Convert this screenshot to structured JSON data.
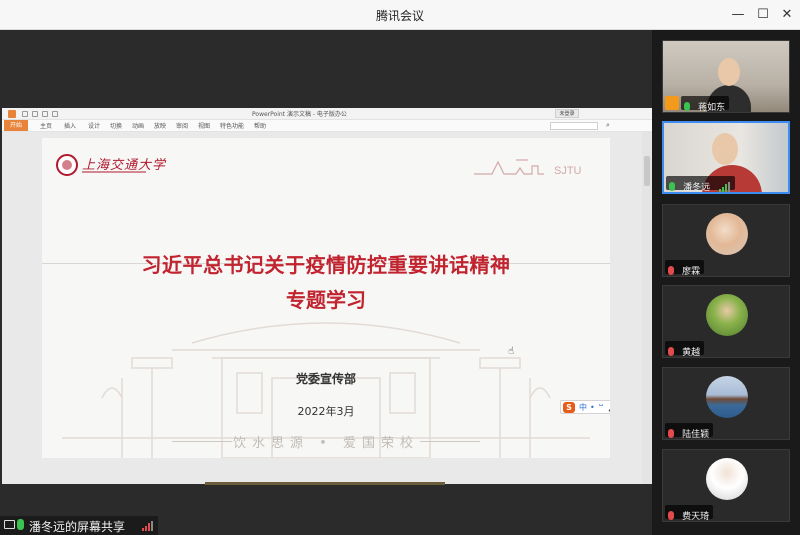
{
  "window": {
    "title": "腾讯会议",
    "controls": {
      "minimize": "—",
      "maximize": "☐",
      "close": "✕"
    }
  },
  "ppt": {
    "doc_title": "PowerPoint 演示文稿 - 电子版办公",
    "login_label": "未登录",
    "tabs": [
      "开始",
      "主页",
      "插入",
      "设计",
      "切换",
      "动画",
      "放映",
      "审阅",
      "视图",
      "特色功能",
      "帮助"
    ],
    "search_icon": "⌕"
  },
  "slide": {
    "logo_text": "上海交通大学",
    "headline_line1": "习近平总书记关于疫情防控重要讲话精神",
    "headline_line2": "专题学习",
    "department": "党委宣传部",
    "date": "2022年3月",
    "motto": "饮水思源 • 爱国荣校",
    "sjtu_mark": "SJTU"
  },
  "ime": {
    "logo": "S",
    "items": [
      "中",
      "•",
      "ⵯ",
      "🎤",
      "⊞",
      "👕",
      "⋮"
    ]
  },
  "share_status": {
    "label": "潘冬远的屏幕共享"
  },
  "participants": [
    {
      "name": "蒋如东",
      "mic": "on",
      "host": true,
      "video": true
    },
    {
      "name": "潘冬远",
      "mic": "on",
      "host": false,
      "video": true,
      "active": true
    },
    {
      "name": "廖霖",
      "mic": "muted",
      "host": false,
      "video": false
    },
    {
      "name": "黄越",
      "mic": "muted",
      "host": false,
      "video": false
    },
    {
      "name": "陆佳颖",
      "mic": "muted",
      "host": false,
      "video": false
    },
    {
      "name": "费天琦",
      "mic": "muted",
      "host": false,
      "video": false
    }
  ],
  "colors": {
    "accent": "#3c8cf2",
    "slide_red": "#c1232f",
    "mic_on": "#3cc34f",
    "mic_muted": "#e14b4b",
    "ppt_orange": "#e8833a"
  }
}
